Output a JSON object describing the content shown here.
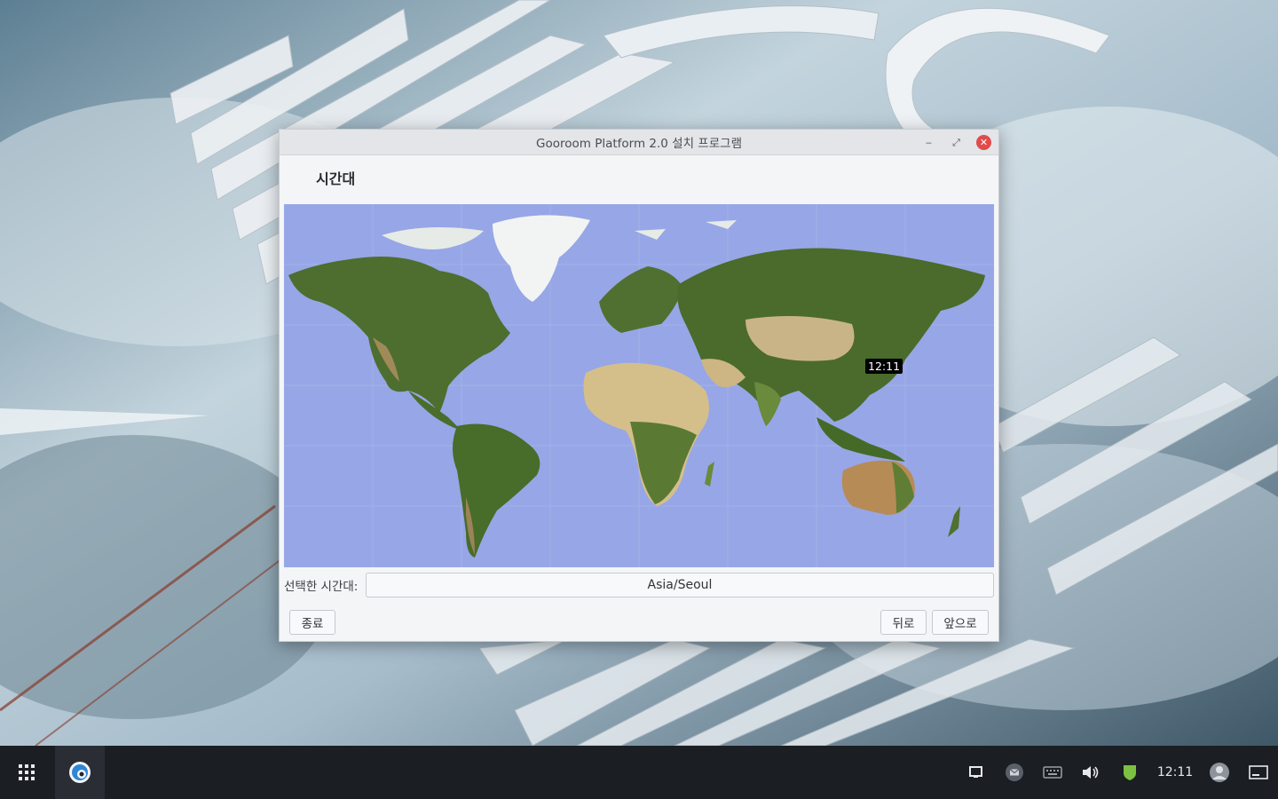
{
  "window": {
    "title": "Gooroom Platform 2.0 설치 프로그램",
    "minimize_icon": "minimize-icon",
    "maximize_icon": "maximize-icon",
    "close_icon": "close-icon"
  },
  "page": {
    "heading": "시간대"
  },
  "map": {
    "time_badge": "12:11",
    "ocean_color": "#97a6e6"
  },
  "timezone": {
    "label": "선택한 시간대:",
    "value": "Asia/Seoul"
  },
  "buttons": {
    "quit": "종료",
    "back": "뒤로",
    "next": "앞으로"
  },
  "taskbar": {
    "apps_icon": "app-grid-icon",
    "browser_icon": "gooroom-browser-icon",
    "tray": [
      "window-list-icon",
      "mail-icon",
      "keyboard-icon",
      "volume-icon",
      "security-shield-icon",
      "user-icon",
      "desktop-show-icon"
    ],
    "clock": "12:11",
    "shield_color": "#7cc142"
  }
}
